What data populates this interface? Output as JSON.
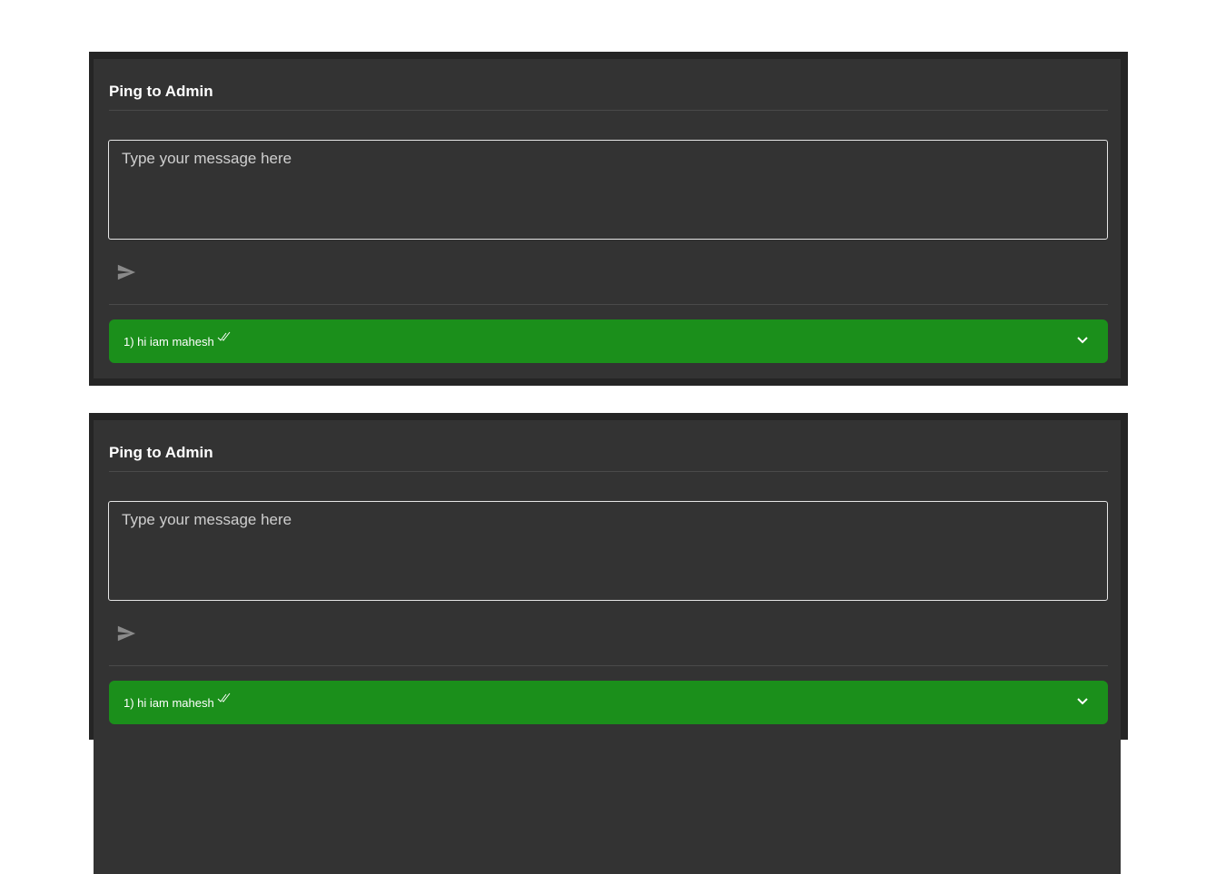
{
  "panels": [
    {
      "title": "Ping to Admin",
      "message_placeholder": "Type your message here",
      "messages": [
        {
          "text": "1) hi iam mahesh",
          "status_icon": "double-check-icon",
          "expand_icon": "chevron-down-icon"
        }
      ]
    },
    {
      "title": "Ping to Admin",
      "message_placeholder": "Type your message here",
      "messages": [
        {
          "text": "1) hi iam mahesh",
          "status_icon": "double-check-icon",
          "expand_icon": "chevron-down-icon"
        }
      ]
    }
  ],
  "colors": {
    "page_background": "#ffffff",
    "panel_border": "#252525",
    "panel_background": "#333333",
    "message_item_background": "#1b8f1b",
    "send_icon": "#8a8a8a",
    "text": "#ffffff"
  },
  "icons": {
    "send": "send-icon",
    "read_status": "double-check-icon",
    "expand": "chevron-down-icon"
  }
}
